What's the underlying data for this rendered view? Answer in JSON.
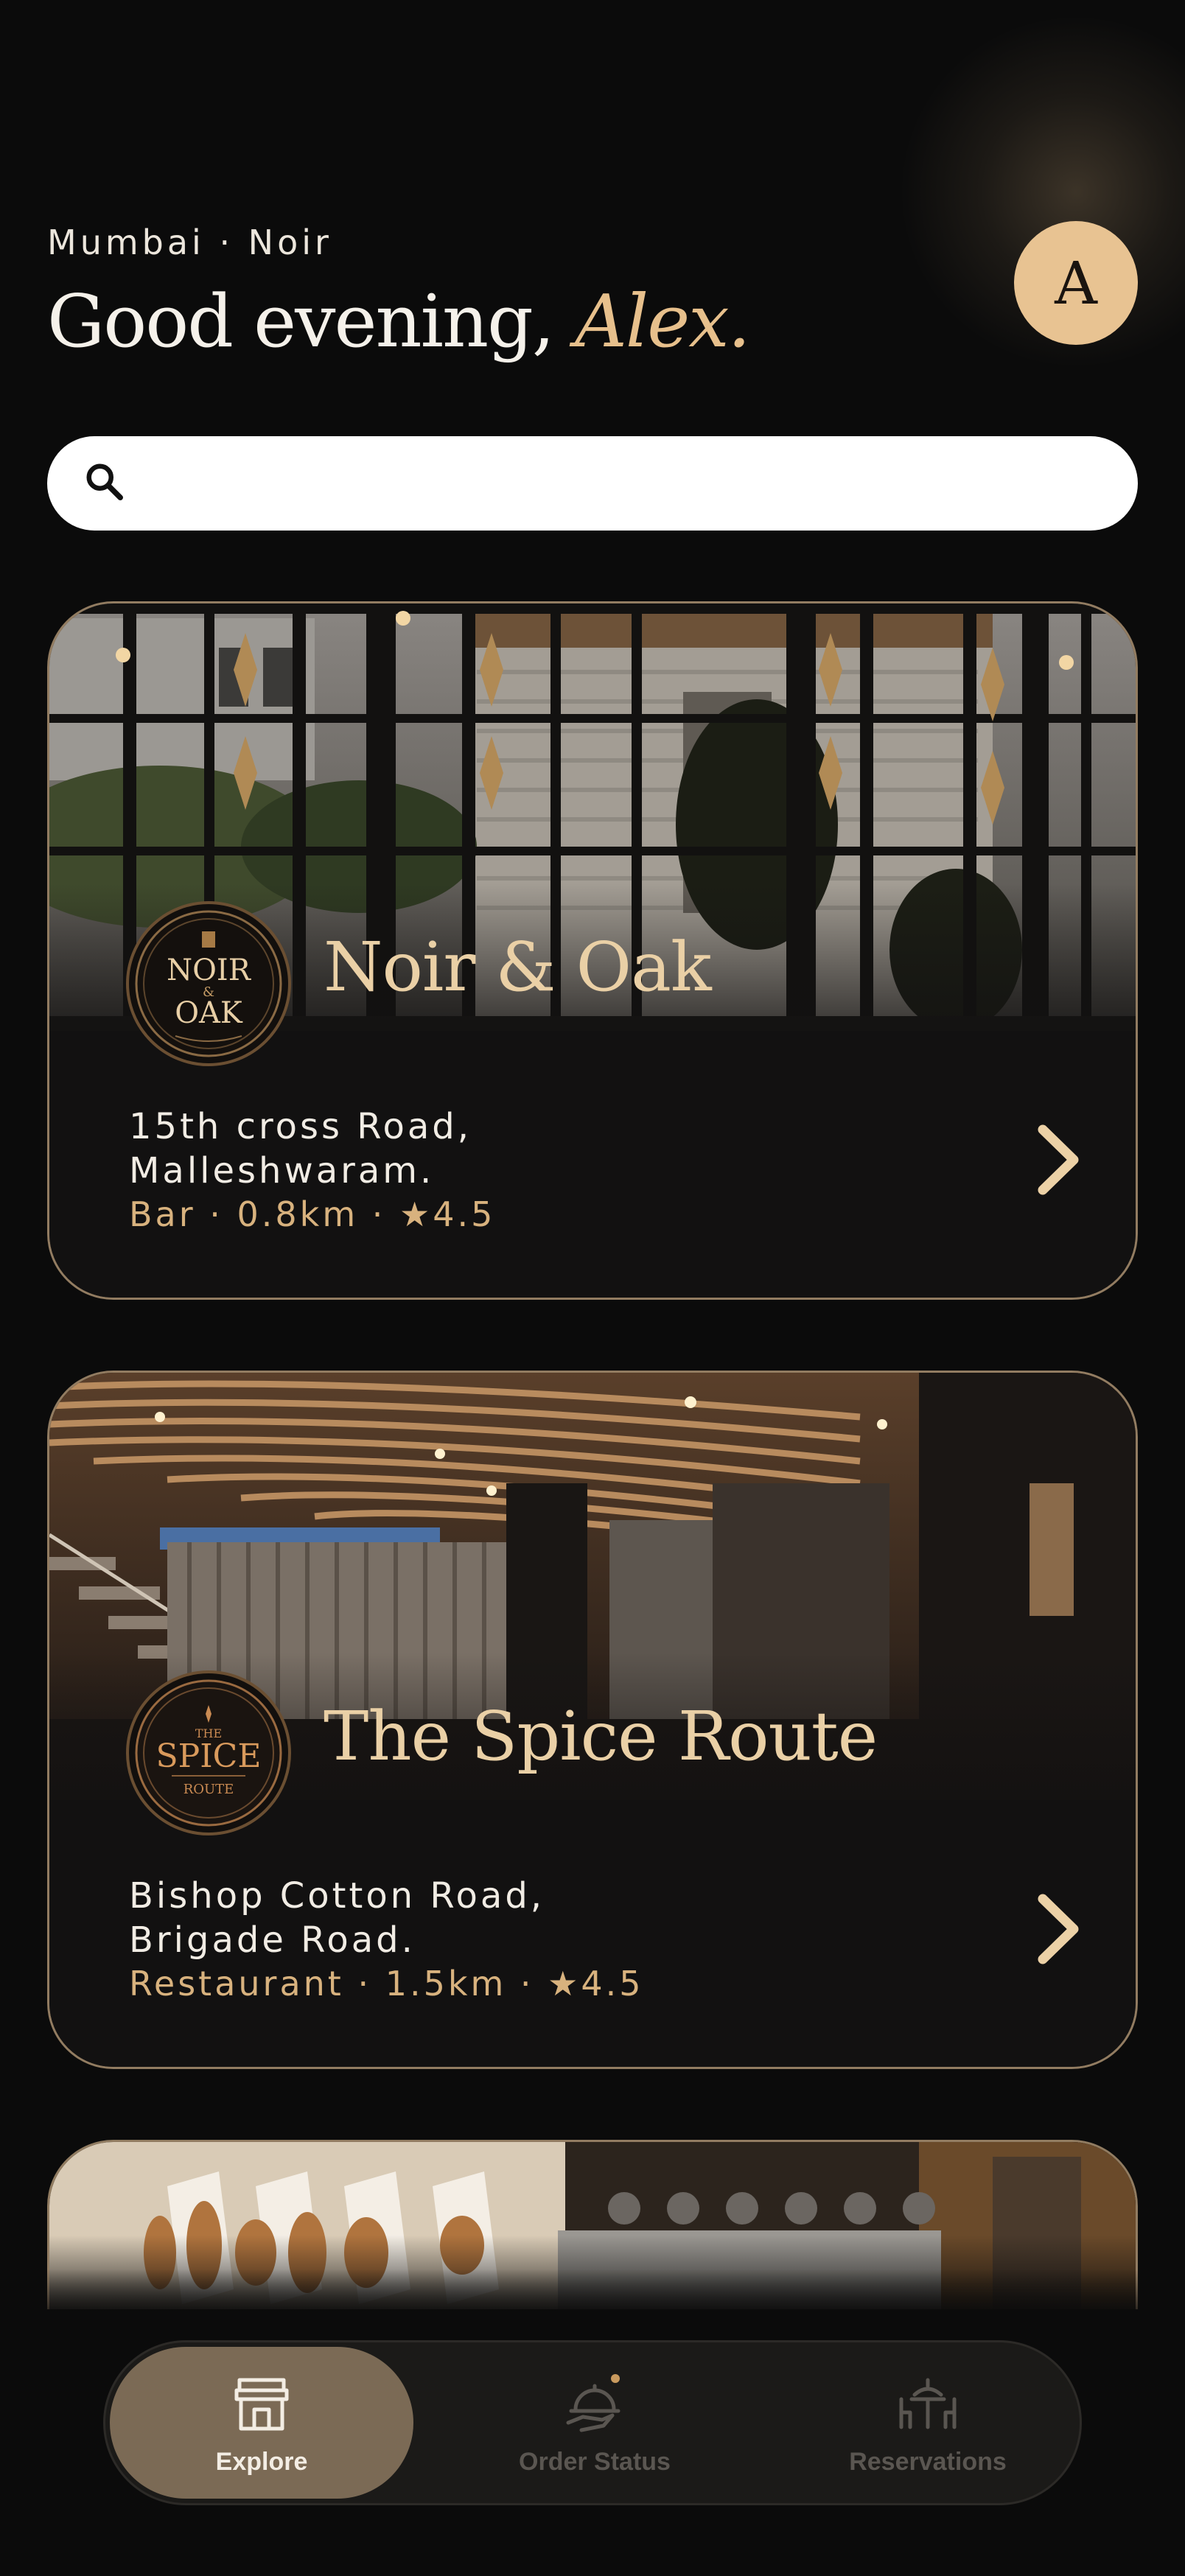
{
  "header": {
    "location": "Mumbai · Noir",
    "greeting_prefix": "Good evening,",
    "greeting_name": "Alex.",
    "avatar_initial": "A"
  },
  "search": {
    "placeholder": "",
    "icon": "search-icon"
  },
  "venues": [
    {
      "name": "Noir & Oak",
      "logo": "noir-and-oak-logo",
      "address_line1": "15th cross Road,",
      "address_line2": "Malleshwaram.",
      "meta": "Bar · 0.8km · ★4.5"
    },
    {
      "name": "The Spice Route",
      "logo": "the-spice-route-logo",
      "address_line1": "Bishop Cotton Road,",
      "address_line2": "Brigade Road.",
      "meta": "Restaurant · 1.5km · ★4.5"
    },
    {
      "name": "",
      "logo": "",
      "address_line1": "",
      "address_line2": "",
      "meta": ""
    }
  ],
  "nav": {
    "items": [
      {
        "label": "Explore",
        "icon": "storefront-icon",
        "active": true
      },
      {
        "label": "Order Status",
        "icon": "serving-cloche-icon",
        "active": false
      },
      {
        "label": "Reservations",
        "icon": "table-chairs-icon",
        "active": false
      }
    ]
  },
  "colors": {
    "background": "#0b0b0b",
    "accent": "#e8c392",
    "card_border": "#d8b78e",
    "nav_active": "#7b6a55"
  }
}
